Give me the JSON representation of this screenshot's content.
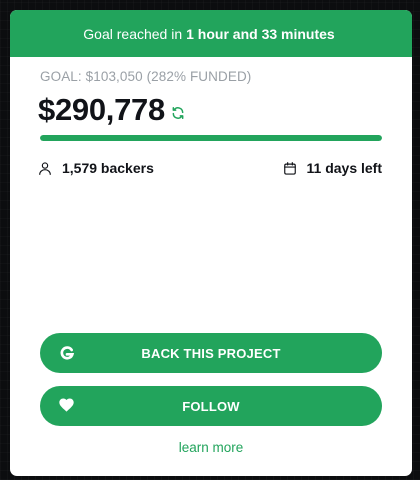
{
  "banner": {
    "prefix": "Goal reached in",
    "duration": "1 hour and 33 minutes"
  },
  "funding": {
    "goal_text": "GOAL: $103,050 (282% FUNDED)",
    "amount": "$290,778",
    "progress_fraction": 1.0
  },
  "stats": {
    "backers": "1,579 backers",
    "days_left": "11 days left"
  },
  "actions": {
    "back_label": "BACK THIS PROJECT",
    "follow_label": "FOLLOW",
    "learn_more": "learn more"
  },
  "icons": {
    "refresh": "refresh-icon",
    "person": "person-icon",
    "calendar": "calendar-icon",
    "back": "gofundme-g-icon",
    "follow": "heart-icon"
  },
  "colors": {
    "accent": "#22a45c",
    "text": "#111318",
    "muted": "#9aa0a6"
  }
}
